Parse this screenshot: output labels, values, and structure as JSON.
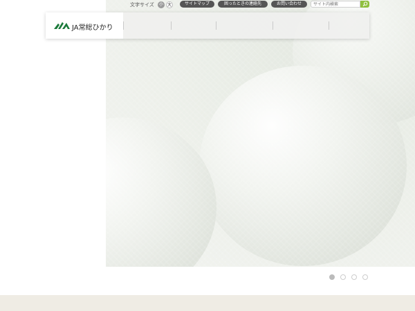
{
  "utility": {
    "font_size_label": "文字サイズ",
    "size_small": "小",
    "size_large": "大",
    "links": [
      "サイトマップ",
      "困ったときの連絡先",
      "お問い合わせ"
    ],
    "search_placeholder": "サイト内検索"
  },
  "header": {
    "logo_text": "JA常総ひかり",
    "nav_items": [
      "",
      "",
      "",
      "",
      ""
    ]
  },
  "slider": {
    "dots": 4,
    "active_index": 0
  },
  "colors": {
    "accent_green": "#8fbf3f",
    "logo_green": "#1a7a3a"
  }
}
